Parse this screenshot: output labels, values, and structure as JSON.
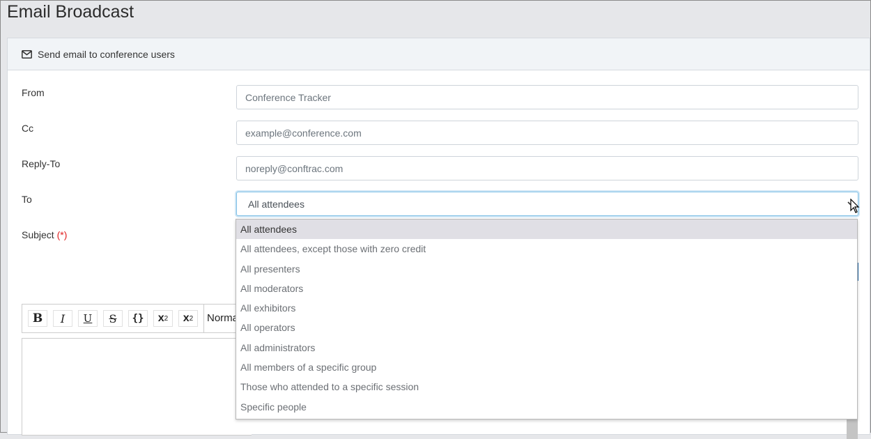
{
  "page": {
    "title": "Email Broadcast"
  },
  "card": {
    "header_icon": "envelope-icon",
    "header_text": "Send email to conference users"
  },
  "form": {
    "from": {
      "label": "From",
      "placeholder": "Conference Tracker"
    },
    "cc": {
      "label": "Cc",
      "placeholder": "example@conference.com"
    },
    "reply_to": {
      "label": "Reply-To",
      "placeholder": "noreply@conftrac.com"
    },
    "to": {
      "label": "To",
      "selected": "All attendees",
      "options": [
        "All attendees",
        "All attendees, except those with zero credit",
        "All presenters",
        "All moderators",
        "All exhibitors",
        "All operators",
        "All administrators",
        "All members of a specific group",
        "Those who attended to a specific session",
        "Specific people"
      ]
    },
    "subject": {
      "label": "Subject",
      "required_marker": "(*)"
    }
  },
  "editor": {
    "toolbar": {
      "bold": "B",
      "italic": "I",
      "underline": "U",
      "strike": "S",
      "code": "{}",
      "superscript": "x",
      "superscript_mark": "2",
      "subscript": "x",
      "subscript_mark": "2",
      "font_size": "Norma"
    }
  },
  "colors": {
    "accent": "#7fc0e6",
    "required": "#e02020",
    "selected_option": "#e0dfe5"
  }
}
